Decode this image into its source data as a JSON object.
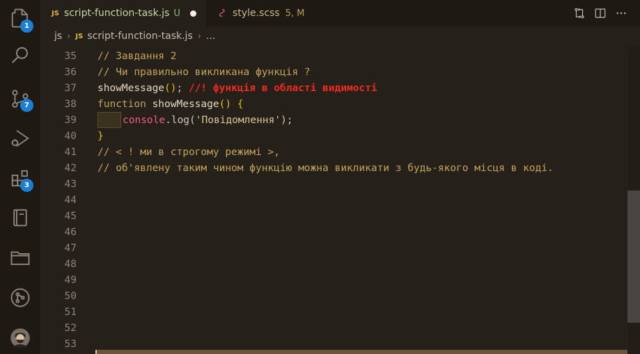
{
  "activity_bar": {
    "items": [
      {
        "icon": "files-icon",
        "badge": "1"
      },
      {
        "icon": "search-icon",
        "badge": null
      },
      {
        "icon": "source-control-icon",
        "badge": "7"
      },
      {
        "icon": "run-debug-icon",
        "badge": null
      },
      {
        "icon": "extensions-icon",
        "badge": "3"
      },
      {
        "icon": "notebook-icon",
        "badge": null
      },
      {
        "icon": "folder-icon",
        "badge": null
      },
      {
        "icon": "git-graph-icon",
        "badge": null
      },
      {
        "icon": "account-avatar-icon",
        "badge": null
      }
    ]
  },
  "tabs": {
    "active": {
      "lang": "JS",
      "name": "script-function-task.js",
      "state": "U"
    },
    "second": {
      "name": "style.scss",
      "state": "5, M"
    }
  },
  "breadcrumb": {
    "folder": "js",
    "file_lang": "JS",
    "file": "script-function-task.js",
    "more": "..."
  },
  "editor": {
    "line_numbers": [
      "35",
      "36",
      "37",
      "38",
      "39",
      "40",
      "41",
      "42",
      "43",
      "44",
      "45",
      "46",
      "47",
      "48",
      "49",
      "50",
      "51",
      "52",
      "53"
    ],
    "lines": {
      "l35": "// Завдання 2",
      "l36": "// Чи правильно викликана функція ?",
      "l37_call": "showMessage",
      "l37_parens": "()",
      "l37_semi": "; ",
      "l37_comment": "//! функція в області видимості",
      "l38_kw": "function ",
      "l38_name": "showMessage",
      "l38_parens": "() {",
      "l39_obj": "console",
      "l39_dot": ".log(",
      "l39_str": "'Повідомлення'",
      "l39_end": ");",
      "l40": "}",
      "l41": "// < ! ми в строгому режимі >,",
      "l42": "// об'явлену таким чином функцію можна викликати з будь-якого місця в коді."
    }
  },
  "colors": {
    "background": "#26201a",
    "comment": "#c3a35a",
    "error_comment": "#f02a1f",
    "badge": "#1b7fd4"
  }
}
